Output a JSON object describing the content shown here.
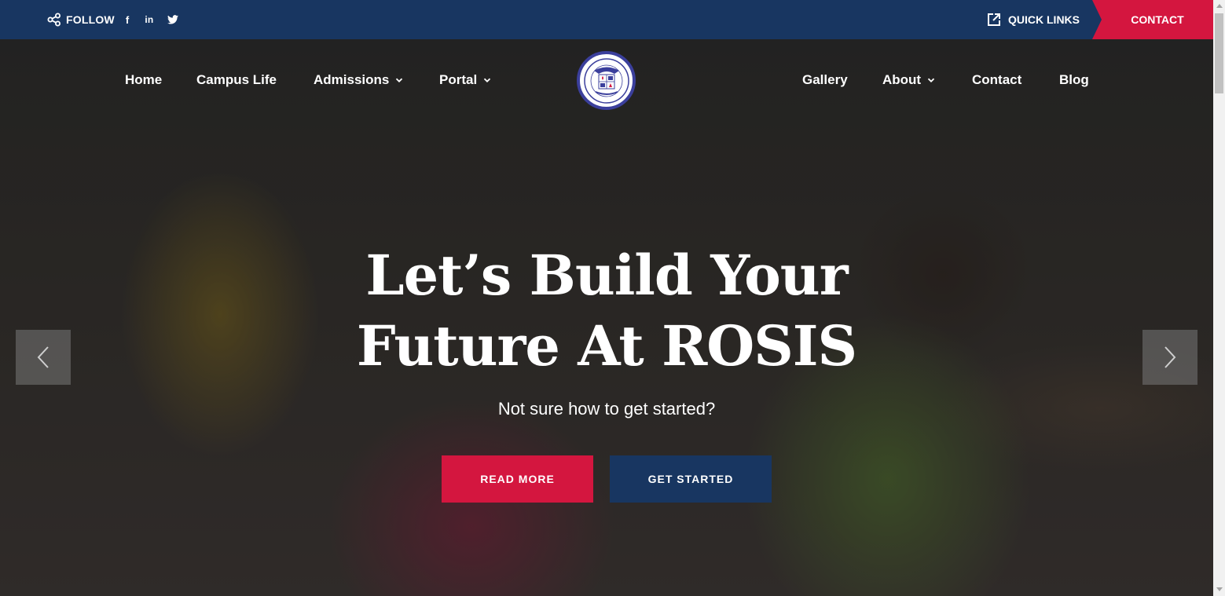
{
  "topbar": {
    "follow_label": "FOLLOW",
    "social": {
      "facebook_glyph": "f",
      "linkedin_glyph": "in",
      "twitter_icon": "twitter-icon"
    },
    "quick_links_label": "QUICK LINKS",
    "contact_label": "CONTACT"
  },
  "nav": {
    "left": [
      {
        "label": "Home"
      },
      {
        "label": "Campus Life"
      },
      {
        "label": "Admissions"
      },
      {
        "label": "Portal"
      }
    ],
    "right": [
      {
        "label": "Gallery"
      },
      {
        "label": "About"
      },
      {
        "label": "Contact"
      },
      {
        "label": "Blog"
      }
    ]
  },
  "hero": {
    "headline_line1": "Let’s Build Your",
    "headline_line2": "Future At ROSIS",
    "subline": "Not sure how to get started?",
    "read_more": "READ MORE",
    "get_started": "GET STARTED"
  },
  "colors": {
    "navy": "#183661",
    "crimson": "#d4163f",
    "logo_ring": "#3b3f9c"
  }
}
